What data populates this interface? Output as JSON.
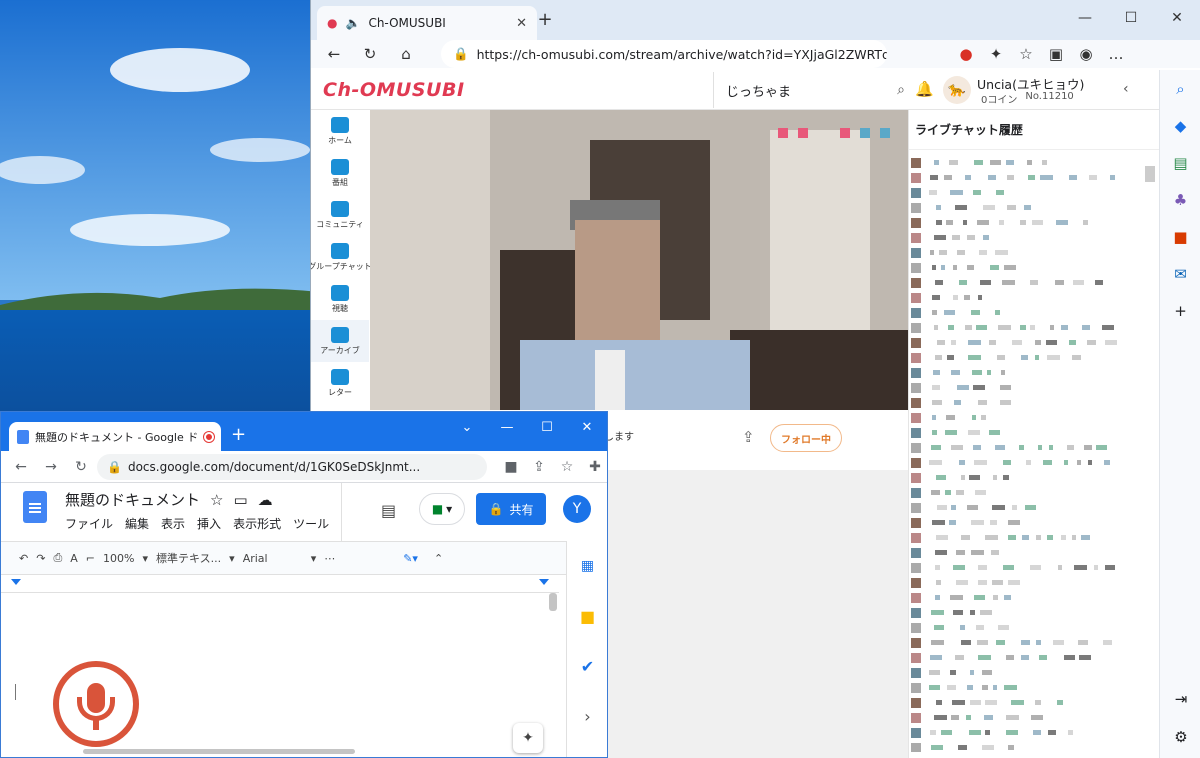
{
  "edge": {
    "tab_title": "Ch-OMUSUBI",
    "url": "https://ch-omusubi.com/stream/archive/watch?id=YXJjaGl2ZWRTdHJlYW0...",
    "close": "✕",
    "new_tab": "+"
  },
  "site": {
    "logo": "Ch-OMUSUBI",
    "search_value": "じっちゃま",
    "user_name": "Uncia(ユキヒョウ)",
    "coins": "0コイン",
    "user_no": "No.11210",
    "nav": [
      {
        "label": "ホーム"
      },
      {
        "label": "番組"
      },
      {
        "label": "コミュニティ"
      },
      {
        "label": "グループチャット"
      },
      {
        "label": "視聴"
      },
      {
        "label": "アーカイブ"
      },
      {
        "label": "レター"
      }
    ],
    "video_caption_tail": "します",
    "follow_label": "フォロー中",
    "chat_title": "ライブチャット履歴"
  },
  "chrome": {
    "tab_title": "無題のドキュメント - Google ド",
    "url": "docs.google.com/document/d/1GK0SeDSkJnmt...",
    "avatar": "Y"
  },
  "docs": {
    "title": "無題のドキュメント",
    "menu": [
      "ファイル",
      "編集",
      "表示",
      "挿入",
      "表示形式",
      "ツール"
    ],
    "share_label": "共有",
    "avatar": "Y",
    "zoom": "100%",
    "style": "標準テキス...",
    "font": "Arial"
  },
  "colors": {
    "accent": "#1a73e8",
    "omusubi_red": "#e03a52",
    "mic_red": "#d9543a"
  }
}
